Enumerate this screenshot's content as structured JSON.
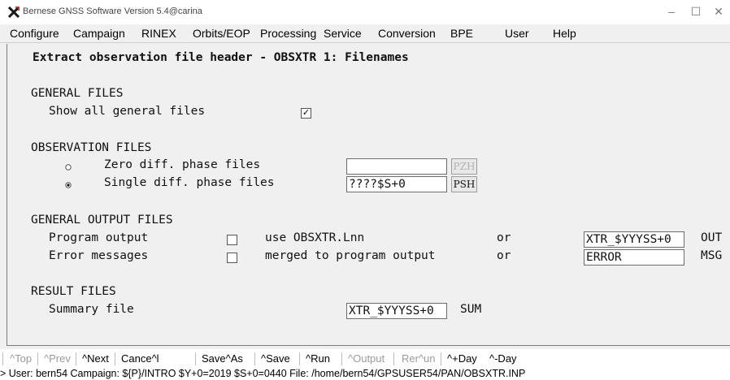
{
  "window": {
    "title": "Bernese GNSS Software Version 5.4@carina"
  },
  "menu": [
    "Configure",
    "Campaign",
    "RINEX",
    "Orbits/EOP",
    "Processing",
    "Service",
    "Conversion",
    "BPE",
    "User",
    "Help"
  ],
  "panel": {
    "title": "Extract observation file header - OBSXTR 1: Filenames",
    "general": {
      "header": "GENERAL FILES",
      "show_all_label": "Show all general files",
      "show_all_checked": true,
      "check_glyph": "✓"
    },
    "observation": {
      "header": "OBSERVATION FILES",
      "zero_label": "Zero diff.   phase files",
      "zero_value": "",
      "zero_button": "PZH",
      "zero_selected": false,
      "single_label": "Single diff. phase files",
      "single_value": "????$S+0",
      "single_button": "PSH",
      "single_selected": true
    },
    "output": {
      "header": "GENERAL OUTPUT FILES",
      "program_label": "Program output",
      "program_note": "use OBSXTR.Lnn",
      "program_or": "or",
      "program_value": "XTR_$YYYSS+0",
      "program_ext": "OUT",
      "error_label": "Error messages",
      "error_note": "merged to program output",
      "error_or": "or",
      "error_value": "ERROR",
      "error_ext": "MSG"
    },
    "result": {
      "header": "RESULT FILES",
      "summary_label": "Summary file",
      "summary_value": "XTR_$YYYSS+0",
      "summary_ext": "SUM"
    }
  },
  "toolbar": {
    "top": "^Top",
    "prev": "^Prev",
    "next": "^Next",
    "cancel": "Cance^l",
    "saveas": "Save^As",
    "save": "^Save",
    "run": "^Run",
    "output": "^Output",
    "rerun": "Rer^un",
    "plusday": "^+Day",
    "minusday": "^-Day"
  },
  "status": "> User: bern54  Campaign: ${P}/INTRO  $Y+0=2019  $S+0=0440  File: /home/bern54/GPSUSER54/PAN/OBSXTR.INP",
  "colors": {
    "panel_bg": "#f0f0f0",
    "field_bg": "#ffffff",
    "disabled_text": "#b3b3b3"
  }
}
